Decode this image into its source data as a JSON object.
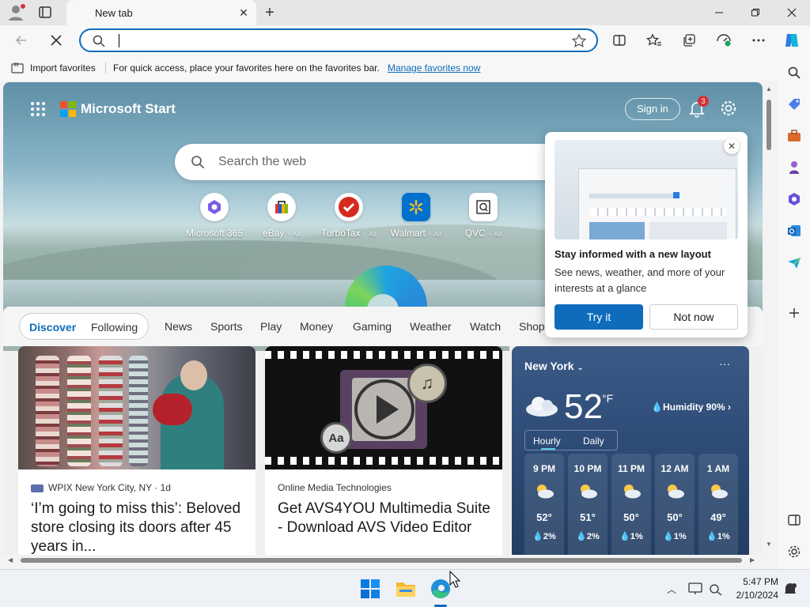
{
  "browser": {
    "tab_title": "New tab",
    "address_value": "",
    "favorites_bar": {
      "import_label": "Import favorites",
      "message": "For quick access, place your favorites here on the favorites bar.",
      "link": "Manage favorites now"
    }
  },
  "page": {
    "brand": "Microsoft Start",
    "sign_in": "Sign in",
    "notification_count": "3",
    "search_placeholder": "Search the web",
    "quick_links": [
      {
        "label": "Microsoft 365",
        "ad": ""
      },
      {
        "label": "eBay",
        "ad": "Ad"
      },
      {
        "label": "TurboTax",
        "ad": "Ad"
      },
      {
        "label": "Walmart",
        "ad": "Ad"
      },
      {
        "label": "QVC",
        "ad": "Ad"
      }
    ],
    "nav": {
      "discover": "Discover",
      "following": "Following",
      "items": [
        "News",
        "Sports",
        "Play",
        "Money",
        "Gaming",
        "Weather",
        "Watch",
        "Shop"
      ]
    },
    "cards": [
      {
        "source": "WPIX New York City, NY · 1d",
        "title": "‘I’m going to miss this’: Beloved store closing its doors after 45 years in..."
      },
      {
        "source": "Online Media Technologies",
        "title": "Get AVS4YOU Multimedia Suite - Download AVS Video Editor",
        "badge": "Aa"
      }
    ],
    "weather": {
      "city": "New York",
      "more": "···",
      "temp": "52",
      "unit": "°F",
      "humidity": "Humidity 90%",
      "tab_hourly": "Hourly",
      "tab_daily": "Daily",
      "hours": [
        {
          "time": "9 PM",
          "temp": "52°",
          "precip": "2%"
        },
        {
          "time": "10 PM",
          "temp": "51°",
          "precip": "2%"
        },
        {
          "time": "11 PM",
          "temp": "50°",
          "precip": "1%"
        },
        {
          "time": "12 AM",
          "temp": "50°",
          "precip": "1%"
        },
        {
          "time": "1 AM",
          "temp": "49°",
          "precip": "1%"
        }
      ]
    },
    "popup": {
      "title": "Stay informed with a new layout",
      "description": "See news, weather, and more of your interests at a glance",
      "primary": "Try it",
      "secondary": "Not now"
    }
  },
  "taskbar": {
    "time": "5:47 PM",
    "date": "2/10/2024"
  },
  "colors": {
    "accent": "#0f6cbd",
    "badge": "#d13438"
  }
}
